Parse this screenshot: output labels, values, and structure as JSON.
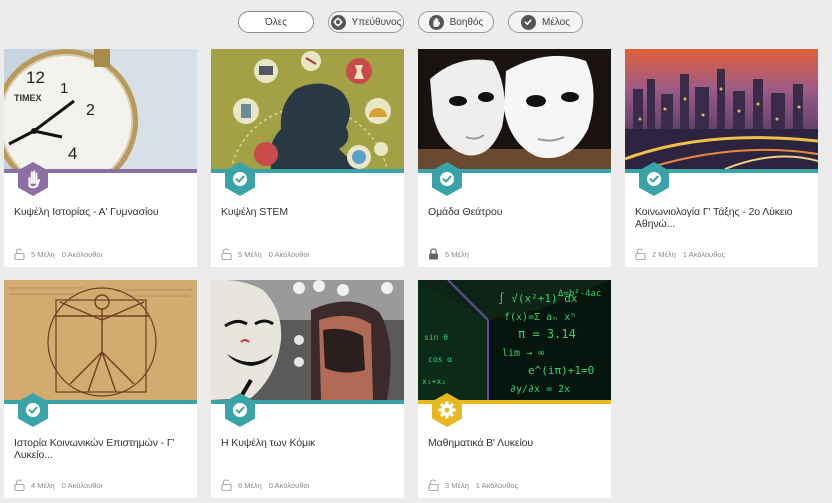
{
  "filters": [
    {
      "label": "Όλες",
      "icon": "none",
      "active": true
    },
    {
      "label": "Υπεύθυνος",
      "icon": "gear-icon",
      "active": false
    },
    {
      "label": "Βοηθός",
      "icon": "hand-icon",
      "active": false
    },
    {
      "label": "Μέλος",
      "icon": "check-icon",
      "active": false
    }
  ],
  "colors": {
    "teal": "#3aa3a8",
    "purple": "#8c6fa3",
    "yellow": "#e8b820",
    "page_bg": "#ececec"
  },
  "groups": [
    {
      "title": "Κυψέλη Ιστορίας - Α' Γυμνασίου",
      "members": "5 Μέλη",
      "followers": "0 Ακόλουθοι",
      "role_icon": "hand-icon",
      "accent": "#8c6fa3",
      "lock": "open",
      "image": "clock"
    },
    {
      "title": "Κυψέλη STEM",
      "members": "5 Μέλη",
      "followers": "0 Ακόλουθοι",
      "role_icon": "check-icon",
      "accent": "#3aa3a8",
      "lock": "open",
      "image": "stem"
    },
    {
      "title": "Ομάδα Θεάτρου",
      "members": "5 Μέλη",
      "followers": "",
      "role_icon": "check-icon",
      "accent": "#3aa3a8",
      "lock": "closed",
      "image": "masks"
    },
    {
      "title": "Κοινωνιολογία Γ' Τάξης - 2ο Λύκειο Αθηνώ...",
      "members": "2 Μέλη",
      "followers": "1 Ακόλουθος",
      "role_icon": "check-icon",
      "accent": "#3aa3a8",
      "lock": "open",
      "image": "city"
    },
    {
      "title": "Ιστορία Κοινωνικών Επιστημών - Γ' Λυκείο...",
      "members": "4 Μέλη",
      "followers": "0 Ακόλουθοι",
      "role_icon": "check-icon",
      "accent": "#3aa3a8",
      "lock": "open",
      "image": "vitruvian"
    },
    {
      "title": "Η Κυψέλη των Κόμικ",
      "members": "6 Μέλη",
      "followers": "0 Ακόλουθοι",
      "role_icon": "check-icon",
      "accent": "#3aa3a8",
      "lock": "open",
      "image": "comic"
    },
    {
      "title": "Μαθηματικά Β' Λυκείου",
      "members": "3 Μέλη",
      "followers": "1 Ακόλουθος",
      "role_icon": "gear-icon",
      "accent": "#e8b820",
      "lock": "open",
      "image": "math"
    }
  ]
}
